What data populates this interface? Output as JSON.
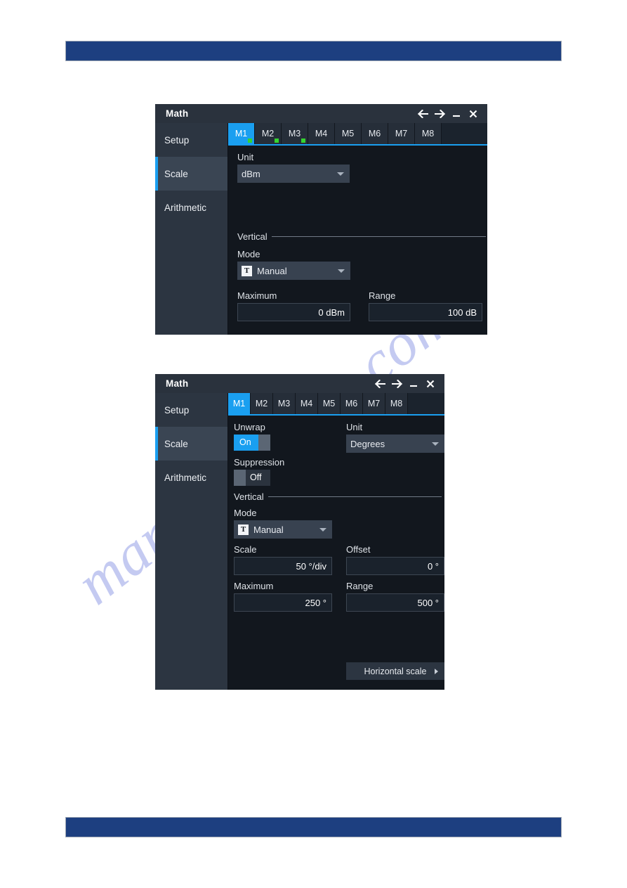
{
  "page": {
    "background": "#ffffff",
    "rule_color": "#1d3f80",
    "watermark": "manualshelve.com"
  },
  "accent": {
    "blue": "#1a9ff0",
    "green_dot": "#35d430",
    "panel_dark": "#12171e",
    "sidebar": "#2c3541"
  },
  "dialog1": {
    "title": "Math",
    "titlebar_buttons": [
      {
        "name": "back-arrow",
        "glyph": "←"
      },
      {
        "name": "forward-arrow",
        "glyph": "→"
      },
      {
        "name": "minimize",
        "glyph": "–"
      },
      {
        "name": "close",
        "glyph": "✕"
      }
    ],
    "sidebar": [
      {
        "label": "Setup",
        "active": false
      },
      {
        "label": "Scale",
        "active": true
      },
      {
        "label": "Arithmetic",
        "active": false
      }
    ],
    "tabs": [
      {
        "label": "M1",
        "active": true,
        "dot": true
      },
      {
        "label": "M2",
        "active": false,
        "dot": true
      },
      {
        "label": "M3",
        "active": false,
        "dot": true
      },
      {
        "label": "M4",
        "active": false,
        "dot": false
      },
      {
        "label": "M5",
        "active": false,
        "dot": false
      },
      {
        "label": "M6",
        "active": false,
        "dot": false
      },
      {
        "label": "M7",
        "active": false,
        "dot": false
      },
      {
        "label": "M8",
        "active": false,
        "dot": false
      }
    ],
    "unit": {
      "label": "Unit",
      "value": "dBm"
    },
    "vertical_section": "Vertical",
    "mode": {
      "label": "Mode",
      "value": "Manual",
      "icon": "T"
    },
    "maximum": {
      "label": "Maximum",
      "value": "0 dBm"
    },
    "range": {
      "label": "Range",
      "value": "100 dB"
    }
  },
  "dialog2": {
    "title": "Math",
    "titlebar_buttons": [
      {
        "name": "back-arrow",
        "glyph": "←"
      },
      {
        "name": "forward-arrow",
        "glyph": "→"
      },
      {
        "name": "minimize",
        "glyph": "–"
      },
      {
        "name": "close",
        "glyph": "✕"
      }
    ],
    "sidebar": [
      {
        "label": "Setup",
        "active": false
      },
      {
        "label": "Scale",
        "active": true
      },
      {
        "label": "Arithmetic",
        "active": false
      }
    ],
    "tabs": [
      {
        "label": "M1",
        "active": true
      },
      {
        "label": "M2",
        "active": false
      },
      {
        "label": "M3",
        "active": false
      },
      {
        "label": "M4",
        "active": false
      },
      {
        "label": "M5",
        "active": false
      },
      {
        "label": "M6",
        "active": false
      },
      {
        "label": "M7",
        "active": false
      },
      {
        "label": "M8",
        "active": false
      }
    ],
    "unwrap": {
      "label": "Unwrap",
      "value": "On",
      "state": "on"
    },
    "unit": {
      "label": "Unit",
      "value": "Degrees"
    },
    "suppression": {
      "label": "Suppression",
      "value": "Off",
      "state": "off"
    },
    "vertical_section": "Vertical",
    "mode": {
      "label": "Mode",
      "value": "Manual",
      "icon": "T"
    },
    "scale": {
      "label": "Scale",
      "value": "50 °/div"
    },
    "offset": {
      "label": "Offset",
      "value": "0 °"
    },
    "maximum": {
      "label": "Maximum",
      "value": "250 °"
    },
    "range": {
      "label": "Range",
      "value": "500 °"
    },
    "horizontal_scale_button": "Horizontal scale"
  }
}
